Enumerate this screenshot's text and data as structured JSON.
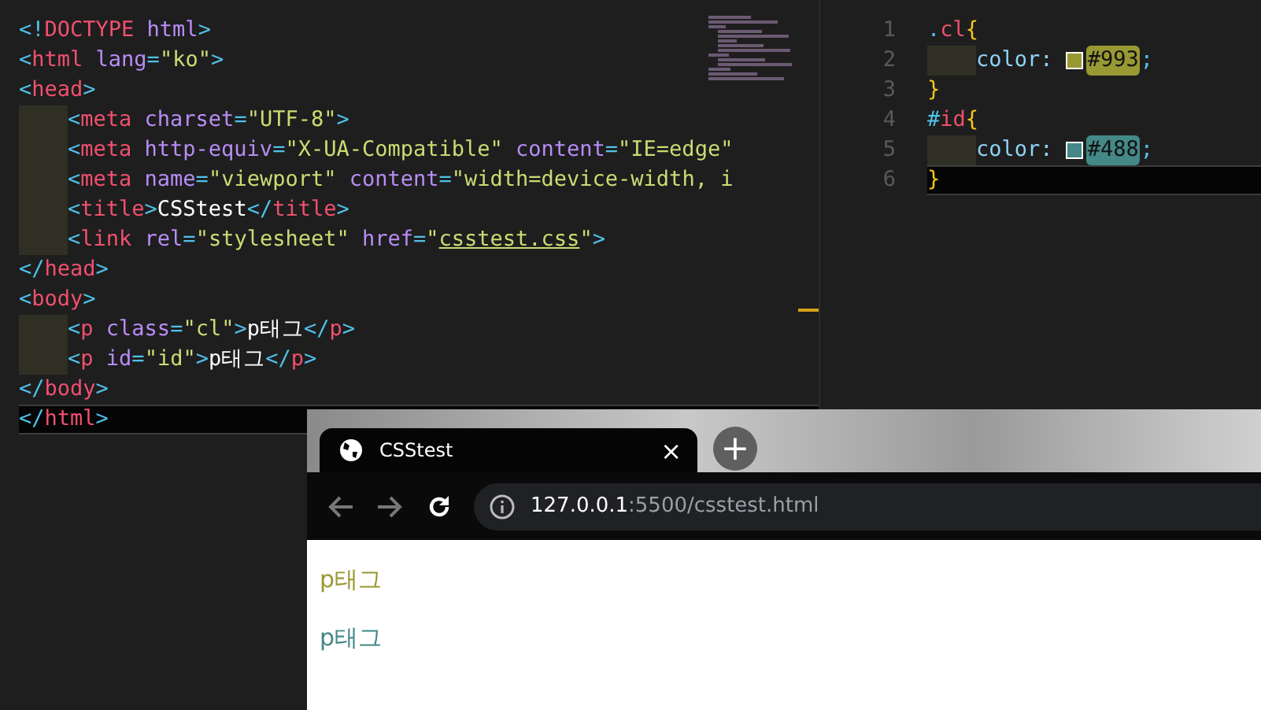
{
  "html_editor": {
    "lines": [
      {
        "indented": false,
        "current": false,
        "tokens": [
          {
            "kind": "bracket",
            "text": "<!"
          },
          {
            "kind": "tag",
            "text": "DOCTYPE"
          },
          {
            "kind": "attr",
            "text": " html"
          },
          {
            "kind": "bracket",
            "text": ">"
          }
        ]
      },
      {
        "indented": false,
        "current": false,
        "tokens": [
          {
            "kind": "bracket",
            "text": "<"
          },
          {
            "kind": "tag",
            "text": "html"
          },
          {
            "kind": "attr",
            "text": " lang"
          },
          {
            "kind": "bracket",
            "text": "="
          },
          {
            "kind": "string",
            "text": "\"ko\""
          },
          {
            "kind": "bracket",
            "text": ">"
          }
        ]
      },
      {
        "indented": false,
        "current": false,
        "tokens": [
          {
            "kind": "bracket",
            "text": "<"
          },
          {
            "kind": "tag",
            "text": "head"
          },
          {
            "kind": "bracket",
            "text": ">"
          }
        ]
      },
      {
        "indented": true,
        "current": false,
        "tokens": [
          {
            "kind": "bracket",
            "text": "<"
          },
          {
            "kind": "tag",
            "text": "meta"
          },
          {
            "kind": "attr",
            "text": " charset"
          },
          {
            "kind": "bracket",
            "text": "="
          },
          {
            "kind": "string",
            "text": "\"UTF-8\""
          },
          {
            "kind": "bracket",
            "text": ">"
          }
        ]
      },
      {
        "indented": true,
        "current": false,
        "tokens": [
          {
            "kind": "bracket",
            "text": "<"
          },
          {
            "kind": "tag",
            "text": "meta"
          },
          {
            "kind": "attr",
            "text": " http-equiv"
          },
          {
            "kind": "bracket",
            "text": "="
          },
          {
            "kind": "string",
            "text": "\"X-UA-Compatible\""
          },
          {
            "kind": "attr",
            "text": " content"
          },
          {
            "kind": "bracket",
            "text": "="
          },
          {
            "kind": "string",
            "text": "\"IE=edge\""
          }
        ]
      },
      {
        "indented": true,
        "current": false,
        "tokens": [
          {
            "kind": "bracket",
            "text": "<"
          },
          {
            "kind": "tag",
            "text": "meta"
          },
          {
            "kind": "attr",
            "text": " name"
          },
          {
            "kind": "bracket",
            "text": "="
          },
          {
            "kind": "string",
            "text": "\"viewport\""
          },
          {
            "kind": "attr",
            "text": " content"
          },
          {
            "kind": "bracket",
            "text": "="
          },
          {
            "kind": "string",
            "text": "\"width=device-width, i"
          }
        ]
      },
      {
        "indented": true,
        "current": false,
        "tokens": [
          {
            "kind": "bracket",
            "text": "<"
          },
          {
            "kind": "tag",
            "text": "title"
          },
          {
            "kind": "bracket",
            "text": ">"
          },
          {
            "kind": "text",
            "text": "CSStest"
          },
          {
            "kind": "bracket",
            "text": "</"
          },
          {
            "kind": "tag",
            "text": "title"
          },
          {
            "kind": "bracket",
            "text": ">"
          }
        ]
      },
      {
        "indented": true,
        "current": false,
        "tokens": [
          {
            "kind": "bracket",
            "text": "<"
          },
          {
            "kind": "tag",
            "text": "link"
          },
          {
            "kind": "attr",
            "text": " rel"
          },
          {
            "kind": "bracket",
            "text": "="
          },
          {
            "kind": "string",
            "text": "\"stylesheet\""
          },
          {
            "kind": "attr",
            "text": " href"
          },
          {
            "kind": "bracket",
            "text": "="
          },
          {
            "kind": "string",
            "text": "\""
          },
          {
            "kind": "link",
            "text": "csstest.css"
          },
          {
            "kind": "string",
            "text": "\""
          },
          {
            "kind": "bracket",
            "text": ">"
          }
        ]
      },
      {
        "indented": false,
        "current": false,
        "tokens": [
          {
            "kind": "bracket",
            "text": "</"
          },
          {
            "kind": "tag",
            "text": "head"
          },
          {
            "kind": "bracket",
            "text": ">"
          }
        ]
      },
      {
        "indented": false,
        "current": false,
        "tokens": [
          {
            "kind": "bracket",
            "text": "<"
          },
          {
            "kind": "tag",
            "text": "body"
          },
          {
            "kind": "bracket",
            "text": ">"
          }
        ]
      },
      {
        "indented": true,
        "current": false,
        "tokens": [
          {
            "kind": "bracket",
            "text": "<"
          },
          {
            "kind": "tag",
            "text": "p"
          },
          {
            "kind": "attr",
            "text": " class"
          },
          {
            "kind": "bracket",
            "text": "="
          },
          {
            "kind": "string",
            "text": "\"cl\""
          },
          {
            "kind": "bracket",
            "text": ">"
          },
          {
            "kind": "text",
            "text": "p태그"
          },
          {
            "kind": "bracket",
            "text": "</"
          },
          {
            "kind": "tag",
            "text": "p"
          },
          {
            "kind": "bracket",
            "text": ">"
          }
        ]
      },
      {
        "indented": true,
        "current": false,
        "tokens": [
          {
            "kind": "bracket",
            "text": "<"
          },
          {
            "kind": "tag",
            "text": "p"
          },
          {
            "kind": "attr",
            "text": " id"
          },
          {
            "kind": "bracket",
            "text": "="
          },
          {
            "kind": "string",
            "text": "\"id\""
          },
          {
            "kind": "bracket",
            "text": ">"
          },
          {
            "kind": "text",
            "text": "p태그"
          },
          {
            "kind": "bracket",
            "text": "</"
          },
          {
            "kind": "tag",
            "text": "p"
          },
          {
            "kind": "bracket",
            "text": ">"
          }
        ]
      },
      {
        "indented": false,
        "current": false,
        "tokens": [
          {
            "kind": "bracket",
            "text": "</"
          },
          {
            "kind": "tag",
            "text": "body"
          },
          {
            "kind": "bracket",
            "text": ">"
          }
        ]
      },
      {
        "indented": false,
        "current": true,
        "tokens": [
          {
            "kind": "bracket",
            "text": "</"
          },
          {
            "kind": "tag",
            "text": "html"
          },
          {
            "kind": "bracket",
            "text": ">"
          }
        ]
      }
    ]
  },
  "css_editor": {
    "lines": [
      {
        "number": "1",
        "indented": false,
        "current": false,
        "tokens": [
          {
            "kind": "punct",
            "text": "."
          },
          {
            "kind": "selector",
            "text": "cl"
          },
          {
            "kind": "brace",
            "text": "{"
          }
        ]
      },
      {
        "number": "2",
        "indented": true,
        "current": false,
        "tokens": [
          {
            "kind": "prop",
            "text": "color: "
          },
          {
            "kind": "color",
            "text": "#993",
            "color": "#999933"
          },
          {
            "kind": "punct",
            "text": ";"
          }
        ]
      },
      {
        "number": "3",
        "indented": false,
        "current": false,
        "tokens": [
          {
            "kind": "brace",
            "text": "}"
          }
        ]
      },
      {
        "number": "4",
        "indented": false,
        "current": false,
        "tokens": [
          {
            "kind": "punct",
            "text": "#"
          },
          {
            "kind": "selector",
            "text": "id"
          },
          {
            "kind": "brace",
            "text": "{"
          }
        ]
      },
      {
        "number": "5",
        "indented": true,
        "current": false,
        "tokens": [
          {
            "kind": "prop",
            "text": "color: "
          },
          {
            "kind": "color",
            "text": "#488",
            "color": "#448888"
          },
          {
            "kind": "punct",
            "text": ";"
          }
        ]
      },
      {
        "number": "6",
        "indented": false,
        "current": true,
        "tokens": [
          {
            "kind": "brace",
            "text": "}"
          }
        ]
      }
    ]
  },
  "browser": {
    "tab": {
      "title": "CSStest",
      "close": "×"
    },
    "new_tab": "+",
    "address": {
      "host": "127.0.0.1",
      "path": ":5500/csstest.html"
    },
    "paragraphs": [
      {
        "text": "p태그",
        "color": "#999933"
      },
      {
        "text": "p태그",
        "color": "#448888"
      }
    ]
  }
}
